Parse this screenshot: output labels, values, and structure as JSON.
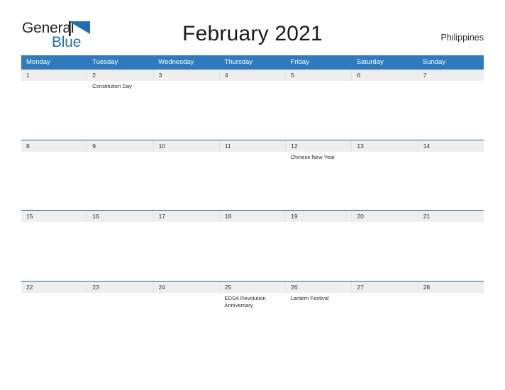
{
  "brand": {
    "name_part1": "General",
    "name_part2": "Blue",
    "flag_icon": "flag-triangle-icon",
    "accent_color": "#1f6eb5"
  },
  "header": {
    "title": "February 2021",
    "country": "Philippines"
  },
  "colors": {
    "header_bar": "#2e7cc0",
    "week_divider": "#1f63a8",
    "date_band": "#eeeeee",
    "text": "#2b2b2b"
  },
  "calendar": {
    "weekdays": [
      "Monday",
      "Tuesday",
      "Wednesday",
      "Thursday",
      "Friday",
      "Saturday",
      "Sunday"
    ],
    "weeks": [
      {
        "days": [
          {
            "date": "1",
            "event": ""
          },
          {
            "date": "2",
            "event": "Constitution Day"
          },
          {
            "date": "3",
            "event": ""
          },
          {
            "date": "4",
            "event": ""
          },
          {
            "date": "5",
            "event": ""
          },
          {
            "date": "6",
            "event": ""
          },
          {
            "date": "7",
            "event": ""
          }
        ]
      },
      {
        "days": [
          {
            "date": "8",
            "event": ""
          },
          {
            "date": "9",
            "event": ""
          },
          {
            "date": "10",
            "event": ""
          },
          {
            "date": "11",
            "event": ""
          },
          {
            "date": "12",
            "event": "Chinese New Year"
          },
          {
            "date": "13",
            "event": ""
          },
          {
            "date": "14",
            "event": ""
          }
        ]
      },
      {
        "days": [
          {
            "date": "15",
            "event": ""
          },
          {
            "date": "16",
            "event": ""
          },
          {
            "date": "17",
            "event": ""
          },
          {
            "date": "18",
            "event": ""
          },
          {
            "date": "19",
            "event": ""
          },
          {
            "date": "20",
            "event": ""
          },
          {
            "date": "21",
            "event": ""
          }
        ]
      },
      {
        "days": [
          {
            "date": "22",
            "event": ""
          },
          {
            "date": "23",
            "event": ""
          },
          {
            "date": "24",
            "event": ""
          },
          {
            "date": "25",
            "event": "EDSA Revolution Anniversary"
          },
          {
            "date": "26",
            "event": "Lantern Festival"
          },
          {
            "date": "27",
            "event": ""
          },
          {
            "date": "28",
            "event": ""
          }
        ]
      }
    ]
  }
}
